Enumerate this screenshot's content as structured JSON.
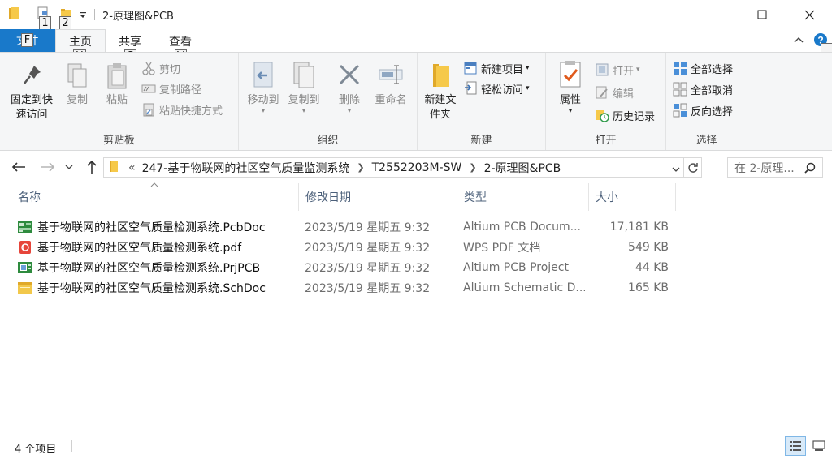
{
  "window": {
    "title": "2-原理图&PCB",
    "keytips": {
      "qa1": "1",
      "qa2": "2"
    }
  },
  "ribbon": {
    "tabs": {
      "file": "文件",
      "home": "主页",
      "share": "共享",
      "view": "查看"
    },
    "keytips": {
      "file": "F",
      "home": "H",
      "share": "S",
      "view": "V"
    },
    "clipboard": {
      "label": "剪贴板",
      "pin": "固定到快速访问",
      "copy": "复制",
      "paste": "粘贴",
      "cut": "剪切",
      "copy_path": "复制路径",
      "paste_shortcut": "粘贴快捷方式"
    },
    "organize": {
      "label": "组织",
      "move_to": "移动到",
      "copy_to": "复制到",
      "delete": "删除",
      "rename": "重命名"
    },
    "new": {
      "label": "新建",
      "new_folder": "新建文件夹",
      "new_item": "新建项目",
      "easy_access": "轻松访问"
    },
    "open": {
      "label": "打开",
      "properties": "属性",
      "open": "打开",
      "edit": "编辑",
      "history": "历史记录"
    },
    "select": {
      "label": "选择",
      "select_all": "全部选择",
      "select_none": "全部取消",
      "invert": "反向选择"
    }
  },
  "address": {
    "prefix": "«",
    "crumbs": [
      "247-基于物联网的社区空气质量监测系统",
      "T2552203M-SW",
      "2-原理图&PCB"
    ],
    "search_placeholder": "在 2-原理..."
  },
  "columns": {
    "name": "名称",
    "date": "修改日期",
    "type": "类型",
    "size": "大小"
  },
  "files": [
    {
      "name": "基于物联网的社区空气质量检测系统.PcbDoc",
      "date": "2023/5/19 星期五 9:32",
      "type": "Altium PCB Docum...",
      "size": "17,181 KB",
      "icon": "pcb-doc-icon"
    },
    {
      "name": "基于物联网的社区空气质量检测系统.pdf",
      "date": "2023/5/19 星期五 9:32",
      "type": "WPS PDF 文档",
      "size": "549 KB",
      "icon": "pdf-icon"
    },
    {
      "name": "基于物联网的社区空气质量检测系统.PrjPCB",
      "date": "2023/5/19 星期五 9:32",
      "type": "Altium PCB Project",
      "size": "44 KB",
      "icon": "pcb-project-icon"
    },
    {
      "name": "基于物联网的社区空气质量检测系统.SchDoc",
      "date": "2023/5/19 星期五 9:32",
      "type": "Altium Schematic D...",
      "size": "165 KB",
      "icon": "schematic-doc-icon"
    }
  ],
  "status": {
    "count": "4 个项目"
  },
  "colors": {
    "accent": "#1979ca",
    "ribbon_bg": "#f5f6f7",
    "header_text": "#4c607a"
  }
}
